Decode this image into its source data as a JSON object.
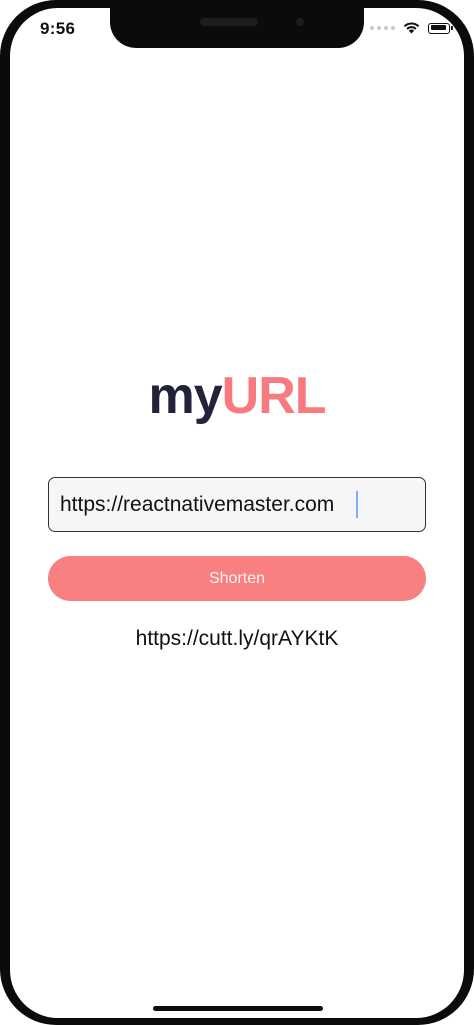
{
  "status_bar": {
    "time": "9:56",
    "icons": [
      "signal-dots-icon",
      "wifi-icon",
      "battery-icon"
    ]
  },
  "app": {
    "logo_part1": "my",
    "logo_part2": "URL",
    "colors": {
      "logo_dark": "#22223b",
      "accent": "#f77b7e",
      "button_bg": "#f98080"
    }
  },
  "form": {
    "url_value": "https://reactnativemaster.com",
    "shorten_label": "Shorten"
  },
  "result": {
    "short_url": "https://cutt.ly/qrAYKtK"
  }
}
